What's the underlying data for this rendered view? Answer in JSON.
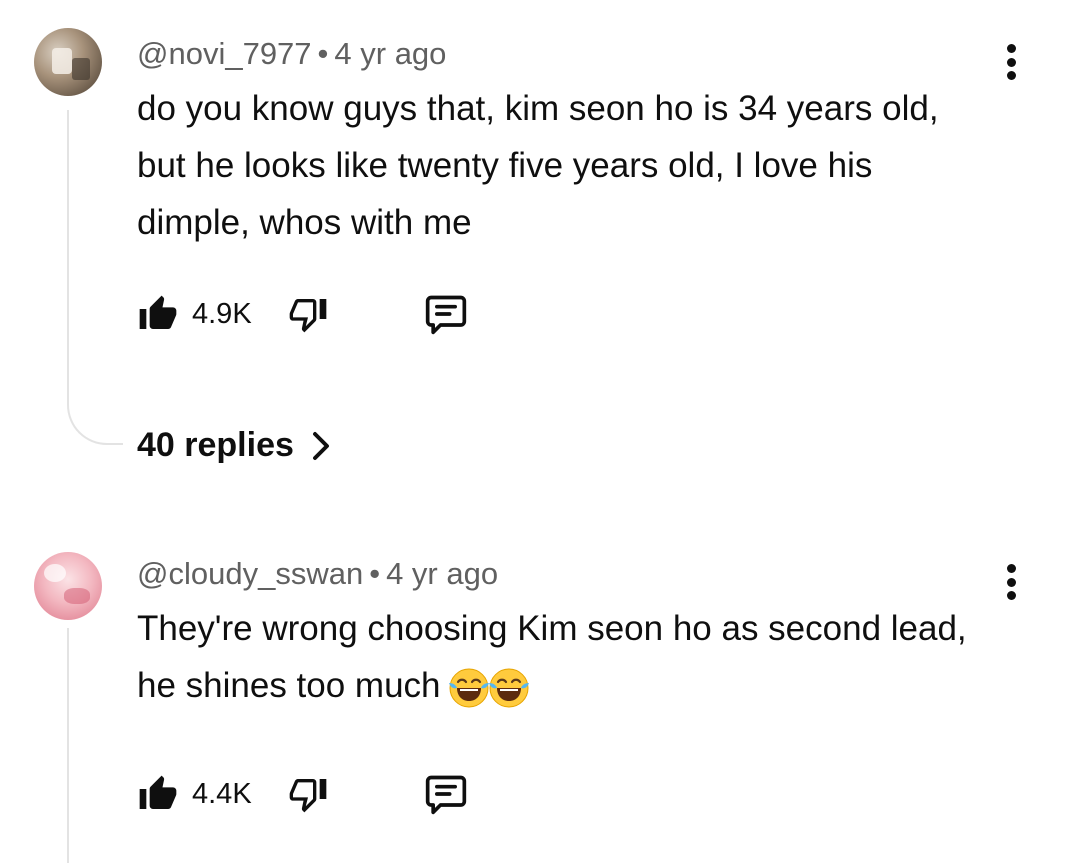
{
  "comments": [
    {
      "username": "@novi_7977",
      "separator": "•",
      "time": "4 yr ago",
      "text": "do you know guys that, kim seon ho is 34 years old, but he looks like twenty five years old, I love his dimple, whos with me",
      "likes": "4.9K",
      "replies_label": "40 replies",
      "icons": [
        "more-vert-icon",
        "thumb-up-icon",
        "thumb-down-icon",
        "comment-icon",
        "chevron-right-icon"
      ]
    },
    {
      "username": "@cloudy_sswan",
      "separator": "•",
      "time": "4 yr ago",
      "text": "They're wrong choosing Kim seon ho as second lead, he shines too much",
      "emoji": "😂😂",
      "likes": "4.4K",
      "icons": [
        "more-vert-icon",
        "thumb-up-icon",
        "thumb-down-icon",
        "comment-icon"
      ]
    }
  ]
}
